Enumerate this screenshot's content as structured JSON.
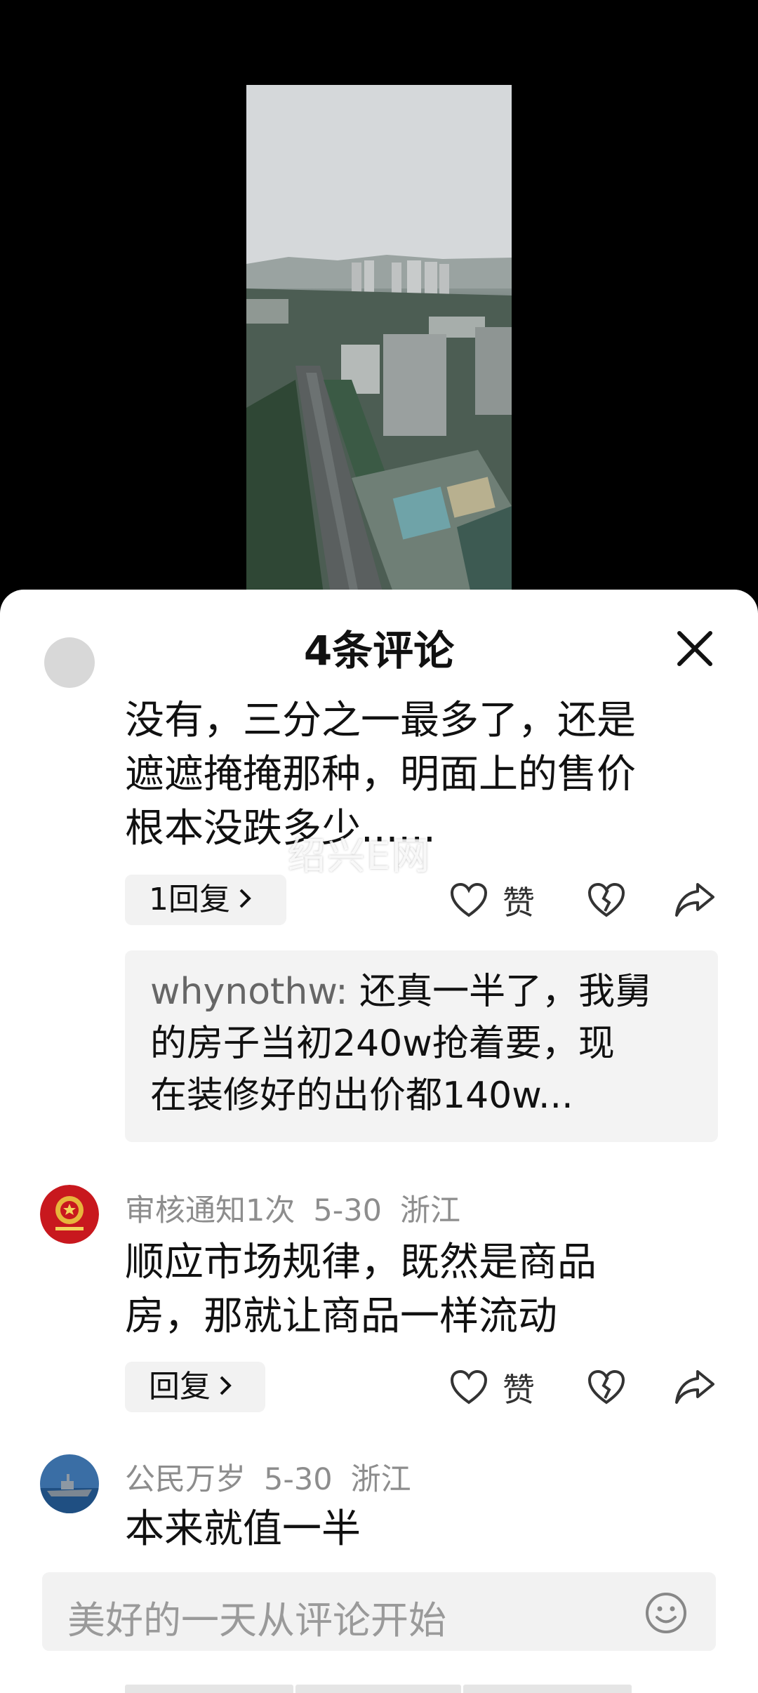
{
  "sheet": {
    "title": "4条评论"
  },
  "comments": [
    {
      "text_lines": [
        "没有，三分之一最多了，还是",
        "遮遮掩掩那种，明面上的售价",
        "根本没跌多少......"
      ],
      "reply_label": "1回复",
      "like_label": "赞",
      "nested_reply": {
        "author": "whynothw:",
        "text_lines": [
          " 还真一半了，我舅",
          "的房子当初240w抢着要，现",
          "在装修好的出价都140w..."
        ]
      }
    },
    {
      "username": "审核通知1次",
      "date": "5-30",
      "location": "浙江",
      "text_lines": [
        "顺应市场规律，既然是商品",
        "房，那就让商品一样流动"
      ],
      "reply_label": "回复",
      "like_label": "赞"
    },
    {
      "username": "公民万岁",
      "date": "5-30",
      "location": "浙江",
      "text_lines": [
        "本来就值一半"
      ]
    }
  ],
  "watermark": "绍兴E网",
  "input": {
    "placeholder": "美好的一天从评论开始"
  },
  "icons": {
    "close": "close-icon",
    "heart": "heart-icon",
    "dislike": "broken-heart-icon",
    "share": "share-icon",
    "emoji": "emoji-icon",
    "chevron": "chevron-right-icon"
  },
  "colors": {
    "sheet_bg": "#ffffff",
    "meta_text": "#8d8d8d",
    "pill_bg": "#f2f2f2",
    "backdrop": "#000000"
  }
}
